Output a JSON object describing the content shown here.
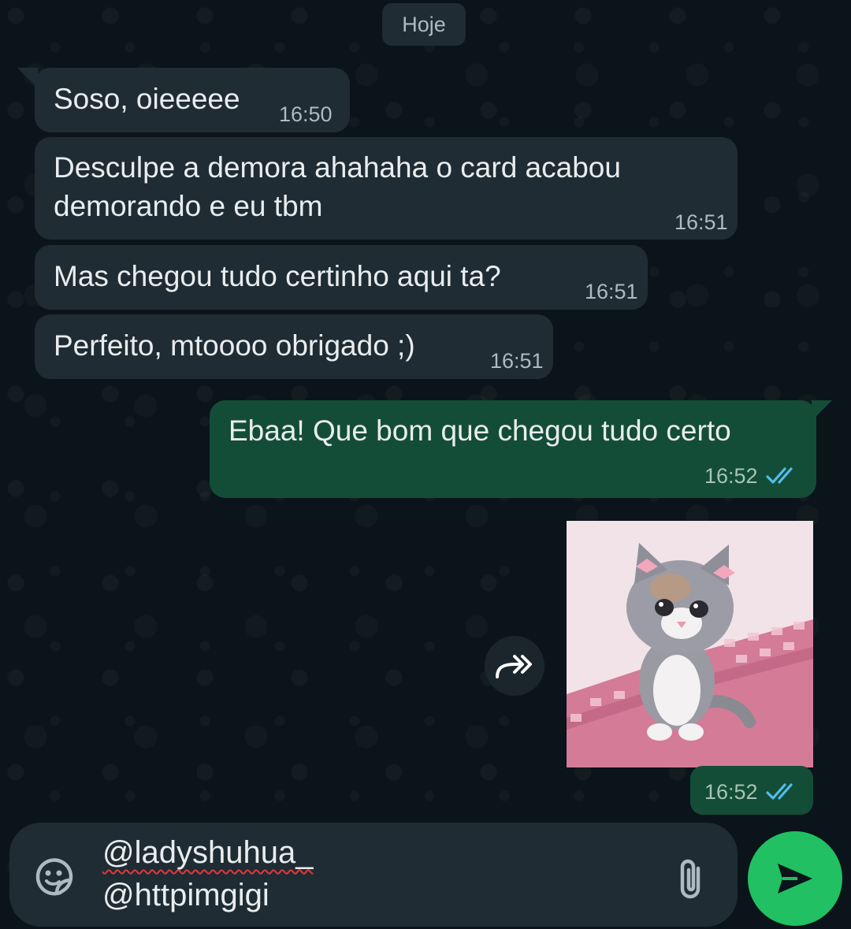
{
  "chat": {
    "date_label": "Hoje",
    "messages": [
      {
        "direction": "incoming",
        "text": "Soso, oieeeee",
        "time": "16:50"
      },
      {
        "direction": "incoming",
        "lines": [
          "Desculpe a demora ahahaha o card acabou",
          "demorando e eu tbm"
        ],
        "time": "16:51"
      },
      {
        "direction": "incoming",
        "text": "Mas chegou tudo certinho aqui ta?",
        "time": "16:51"
      },
      {
        "direction": "incoming",
        "text": "Perfeito, mtoooo obrigado ;)",
        "time": "16:51"
      },
      {
        "direction": "outgoing",
        "text": "Ebaa! Que bom que chegou tudo certo",
        "time": "16:52",
        "status": "read"
      },
      {
        "direction": "outgoing",
        "type": "image",
        "time": "16:52",
        "status": "read"
      }
    ]
  },
  "composer": {
    "lines": [
      "@ladyshuhua_",
      "@httpimgigi"
    ]
  },
  "icons": {
    "forward": "forward-icon",
    "sticker": "sticker-icon",
    "attach": "paperclip-icon",
    "send": "send-icon",
    "read_receipt": "double-check-icon"
  },
  "colors": {
    "background": "#0b141a",
    "incoming_bubble": "#202c33",
    "outgoing_bubble": "#144d37",
    "send_button": "#21c063",
    "read_ticks": "#53bdeb"
  }
}
